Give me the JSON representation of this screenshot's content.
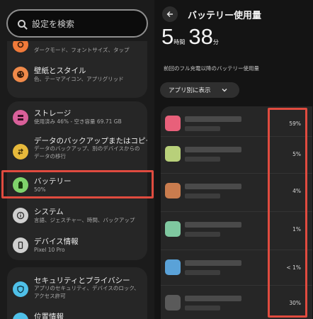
{
  "settings": {
    "search_placeholder": "設定を検索",
    "items": [
      {
        "title": "",
        "subtitle": "ダークモード、フォントサイズ、タップ",
        "icon": "display-icon",
        "color": "#f07a3a"
      },
      {
        "title": "壁紙とスタイル",
        "subtitle": "色、テーマアイコン、アプリグリッド",
        "icon": "palette-icon",
        "color": "#f08a4a"
      },
      {
        "title": "ストレージ",
        "subtitle": "使用済み 46% - 空き容量 69.71 GB",
        "icon": "storage-icon",
        "color": "#d9609a"
      },
      {
        "title": "データのバックアップまたはコピー",
        "subtitle": "データのバックアップ、別のデバイスからのデータの移行",
        "icon": "sync-icon",
        "color": "#e7b93b"
      },
      {
        "title": "バッテリー",
        "subtitle": "50%",
        "icon": "battery-icon",
        "color": "#7fd36b"
      },
      {
        "title": "システム",
        "subtitle": "言語、ジェスチャー、時間、バックアップ",
        "icon": "info-icon",
        "color": "#d0d0d0"
      },
      {
        "title": "デバイス情報",
        "subtitle": "Pixel 10 Pro",
        "icon": "device-icon",
        "color": "#d0d0d0"
      },
      {
        "title": "セキュリティとプライバシー",
        "subtitle": "アプリのセキュリティ、デバイスのロック、アクセス許可",
        "icon": "shield-icon",
        "color": "#4fc0e8"
      },
      {
        "title": "位置情報",
        "subtitle": "",
        "icon": "location-icon",
        "color": "#4fc0e8"
      }
    ]
  },
  "battery_usage": {
    "title": "バッテリー使用量",
    "hours": "5",
    "hours_unit": "時間",
    "minutes": "38",
    "minutes_unit": "分",
    "caption": "前回のフル充電以降のバッテリー使用量",
    "dropdown_label": "アプリ別に表示",
    "apps": [
      {
        "percent": "59%",
        "icon_color": "#e8607a"
      },
      {
        "percent": "5%",
        "icon_color": "#b8d07a"
      },
      {
        "percent": "4%",
        "icon_color": "#c97c4e"
      },
      {
        "percent": "1%",
        "icon_color": "#7fc8a0"
      },
      {
        "percent": "< 1%",
        "icon_color": "#5aa2d8"
      },
      {
        "percent": "30%",
        "icon_color": "#5a5a5a"
      }
    ]
  }
}
